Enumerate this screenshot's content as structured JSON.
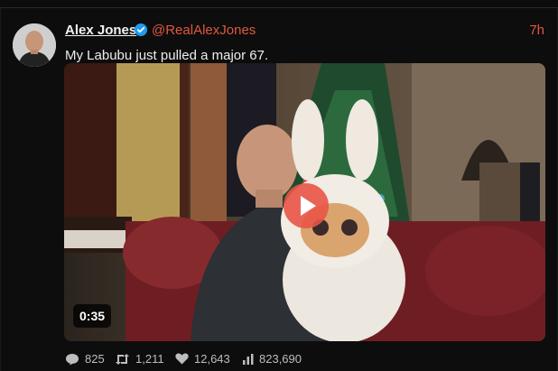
{
  "tweet": {
    "author_name": "Alex Jones",
    "handle": "@RealAlexJones",
    "timestamp": "7h",
    "text": "My Labubu just pulled a major 67.",
    "verified": true
  },
  "media": {
    "type": "video",
    "duration": "0:35",
    "play_icon": "play-icon"
  },
  "stats": {
    "replies": "825",
    "retweets": "1,211",
    "likes": "12,643",
    "views": "823,690"
  },
  "colors": {
    "accent": "#e0573e",
    "verified": "#1d9bf0",
    "background": "#0d0d0d"
  }
}
